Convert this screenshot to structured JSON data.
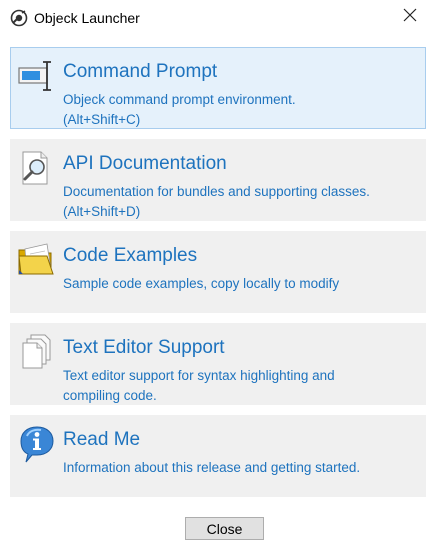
{
  "window": {
    "title": "Objeck Launcher",
    "app_icon": "objeck-logo-icon",
    "close_icon": "close-icon"
  },
  "items": [
    {
      "icon": "terminal-icon",
      "title": "Command Prompt",
      "desc_lines": [
        "Objeck command prompt environment.",
        "(Alt+Shift+C)"
      ],
      "selected": true
    },
    {
      "icon": "magnifier-document-icon",
      "title": "API Documentation",
      "desc_lines": [
        "Documentation for bundles and supporting classes.",
        "(Alt+Shift+D)"
      ],
      "selected": false
    },
    {
      "icon": "folder-icon",
      "title": "Code Examples",
      "desc_lines": [
        "Sample code examples, copy locally to modify"
      ],
      "selected": false
    },
    {
      "icon": "documents-icon",
      "title": "Text Editor Support",
      "desc_lines": [
        "Text editor support for syntax highlighting and",
        "compiling code."
      ],
      "selected": false
    },
    {
      "icon": "info-icon",
      "title": "Read Me",
      "desc_lines": [
        "Information about this release and getting started."
      ],
      "selected": false
    }
  ],
  "footer": {
    "close_label": "Close"
  },
  "colors": {
    "accent_text": "#1e73be",
    "item_bg": "#f0f0f0",
    "selected_bg": "#e5f1fb",
    "selected_border": "#a8cdee"
  }
}
